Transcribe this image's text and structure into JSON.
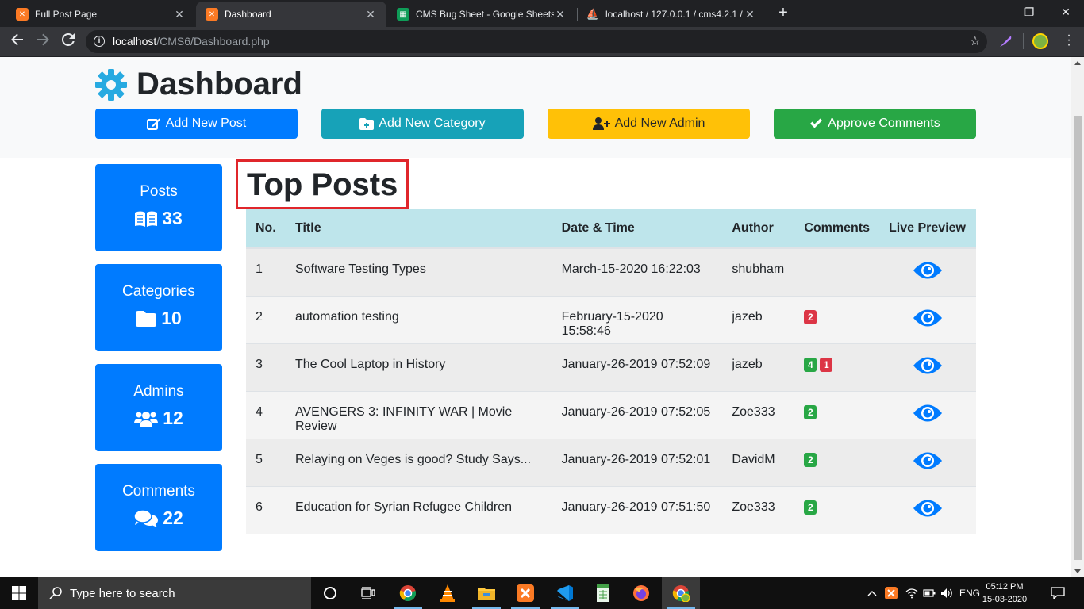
{
  "browser": {
    "tabs": [
      {
        "title": "Full Post Page",
        "favicon": "xampp-icon",
        "active": false
      },
      {
        "title": "Dashboard",
        "favicon": "xampp-icon",
        "active": true
      },
      {
        "title": "CMS Bug Sheet - Google Sheets",
        "favicon": "google-sheets-icon",
        "active": false
      },
      {
        "title": "localhost / 127.0.0.1 / cms4.2.1 /",
        "favicon": "phpmyadmin-icon",
        "active": false
      }
    ],
    "url_host": "localhost",
    "url_path": "/CMS6/Dashboard.php"
  },
  "page": {
    "title": "Dashboard",
    "actions": [
      {
        "label": "Add New Post",
        "color": "#007bff",
        "icon": "edit-icon"
      },
      {
        "label": "Add New Category",
        "color": "#17a2b8",
        "icon": "folder-plus-icon"
      },
      {
        "label": "Add New Admin",
        "color": "#ffc107",
        "icon": "user-plus-icon"
      },
      {
        "label": "Approve Comments",
        "color": "#28a745",
        "icon": "check-icon"
      }
    ],
    "stats": [
      {
        "label": "Posts",
        "value": "33",
        "icon": "book-open-icon"
      },
      {
        "label": "Categories",
        "value": "10",
        "icon": "folder-icon"
      },
      {
        "label": "Admins",
        "value": "12",
        "icon": "users-icon"
      },
      {
        "label": "Comments",
        "value": "22",
        "icon": "comments-icon"
      }
    ],
    "section_title": "Top Posts",
    "table": {
      "headers": [
        "No.",
        "Title",
        "Date & Time",
        "Author",
        "Comments",
        "Live Preview"
      ],
      "rows": [
        {
          "no": "1",
          "title": "Software Testing Types",
          "date": "March-15-2020 16:22:03",
          "author": "shubham",
          "approved": "",
          "pending": ""
        },
        {
          "no": "2",
          "title": "automation testing",
          "date": "February-15-2020 15:58:46",
          "author": "jazeb",
          "approved": "",
          "pending": "2"
        },
        {
          "no": "3",
          "title": "The Cool Laptop in History",
          "date": "January-26-2019 07:52:09",
          "author": "jazeb",
          "approved": "4",
          "pending": "1"
        },
        {
          "no": "4",
          "title": "AVENGERS 3: INFINITY WAR | Movie Review",
          "date": "January-26-2019 07:52:05",
          "author": "Zoe333",
          "approved": "2",
          "pending": ""
        },
        {
          "no": "5",
          "title": "Relaying on Veges is good? Study Says...",
          "date": "January-26-2019 07:52:01",
          "author": "DavidM",
          "approved": "2",
          "pending": ""
        },
        {
          "no": "6",
          "title": "Education for Syrian Refugee Children",
          "date": "January-26-2019 07:51:50",
          "author": "Zoe333",
          "approved": "2",
          "pending": ""
        }
      ]
    }
  },
  "taskbar": {
    "search_placeholder": "Type here to search",
    "language": "ENG",
    "time": "05:12 PM",
    "date": "15-03-2020"
  },
  "colors": {
    "primary": "#007bff",
    "badge_green": "#28a745",
    "badge_red": "#dc3545",
    "table_header": "#bee5eb",
    "highlight_border": "#e0262b"
  }
}
